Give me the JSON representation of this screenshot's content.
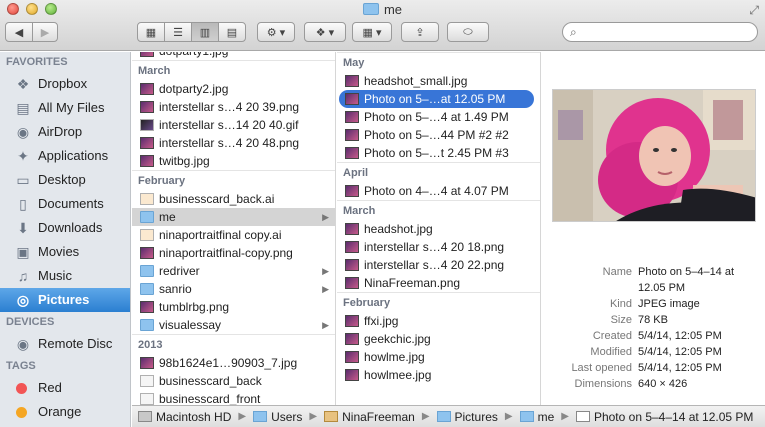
{
  "window": {
    "title": "me"
  },
  "toolbar": {
    "back_icon": "◀",
    "forward_icon": "▶",
    "view_icons": [
      "▦",
      "☰",
      "▥",
      "▤"
    ],
    "action_icon": "⚙ ▾",
    "dropbox_icon": "❖ ▾",
    "arrange_icon": "▦ ▾",
    "share_icon": "⇪",
    "tags_icon": "⬭",
    "search_placeholder": ""
  },
  "sidebar": {
    "sections": [
      {
        "header": "FAVORITES",
        "items": [
          {
            "label": "Dropbox",
            "icon": "❖"
          },
          {
            "label": "All My Files",
            "icon": "▤"
          },
          {
            "label": "AirDrop",
            "icon": "◉"
          },
          {
            "label": "Applications",
            "icon": "✦"
          },
          {
            "label": "Desktop",
            "icon": "▭"
          },
          {
            "label": "Documents",
            "icon": "▯"
          },
          {
            "label": "Downloads",
            "icon": "⬇"
          },
          {
            "label": "Movies",
            "icon": "▣"
          },
          {
            "label": "Music",
            "icon": "♫"
          },
          {
            "label": "Pictures",
            "icon": "◎",
            "selected": true
          }
        ]
      },
      {
        "header": "DEVICES",
        "items": [
          {
            "label": "Remote Disc",
            "icon": "◉"
          }
        ]
      },
      {
        "header": "TAGS",
        "items": [
          {
            "label": "Red",
            "color": "#f25555"
          },
          {
            "label": "Orange",
            "color": "#f5a623"
          }
        ]
      }
    ]
  },
  "column1": {
    "groups": [
      {
        "header": "",
        "items": [
          {
            "name": "dotparty1.jpg",
            "type": "img"
          }
        ]
      },
      {
        "header": "March",
        "items": [
          {
            "name": "dotparty2.jpg",
            "type": "img"
          },
          {
            "name": "interstellar s…4 20 39.png",
            "type": "img"
          },
          {
            "name": "interstellar s…14 20 40.gif",
            "type": "gif"
          },
          {
            "name": "interstellar s…4 20 48.png",
            "type": "img"
          },
          {
            "name": "twitbg.jpg",
            "type": "img"
          }
        ]
      },
      {
        "header": "February",
        "items": [
          {
            "name": "businesscard_back.ai",
            "type": "ai"
          },
          {
            "name": "me",
            "type": "fold",
            "folder": true,
            "selected": true
          },
          {
            "name": "ninaportraitfinal copy.ai",
            "type": "ai"
          },
          {
            "name": "ninaportraitfinal-copy.png",
            "type": "img"
          },
          {
            "name": "redriver",
            "type": "fold",
            "folder": true
          },
          {
            "name": "sanrio",
            "type": "fold",
            "folder": true
          },
          {
            "name": "tumblrbg.png",
            "type": "img"
          },
          {
            "name": "visualessay",
            "type": "fold",
            "folder": true
          }
        ]
      },
      {
        "header": "2013",
        "items": [
          {
            "name": "98b1624e1…90903_7.jpg",
            "type": "img"
          },
          {
            "name": "businesscard_back",
            "type": "doc"
          },
          {
            "name": "businesscard_front",
            "type": "doc"
          }
        ]
      }
    ]
  },
  "column2": {
    "groups": [
      {
        "header": "May",
        "items": [
          {
            "name": "headshot_small.jpg",
            "type": "img"
          },
          {
            "name": "Photo on 5–…at 12.05 PM",
            "type": "img",
            "selected": true
          },
          {
            "name": "Photo on 5–…4 at 1.49 PM",
            "type": "img"
          },
          {
            "name": "Photo on 5–…44 PM #2 #2",
            "type": "img"
          },
          {
            "name": "Photo on 5–…t 2.45 PM #3",
            "type": "img"
          }
        ]
      },
      {
        "header": "April",
        "items": [
          {
            "name": "Photo on 4–…4 at 4.07 PM",
            "type": "img"
          }
        ]
      },
      {
        "header": "March",
        "items": [
          {
            "name": "headshot.jpg",
            "type": "img"
          },
          {
            "name": "interstellar s…4 20 18.png",
            "type": "img"
          },
          {
            "name": "interstellar s…4 20 22.png",
            "type": "img"
          },
          {
            "name": "NinaFreeman.png",
            "type": "img"
          }
        ]
      },
      {
        "header": "February",
        "items": [
          {
            "name": "ffxi.jpg",
            "type": "img"
          },
          {
            "name": "geekchic.jpg",
            "type": "img"
          },
          {
            "name": "howlme.jpg",
            "type": "img"
          },
          {
            "name": "howlmee.jpg",
            "type": "img"
          }
        ]
      }
    ]
  },
  "preview": {
    "info": [
      {
        "key": "Name",
        "value": "Photo on 5–4–14 at",
        "value2": "12.05 PM"
      },
      {
        "key": "Kind",
        "value": "JPEG image"
      },
      {
        "key": "Size",
        "value": "78 KB"
      },
      {
        "key": "Created",
        "value": "5/4/14, 12:05 PM"
      },
      {
        "key": "Modified",
        "value": "5/4/14, 12:05 PM"
      },
      {
        "key": "Last opened",
        "value": "5/4/14, 12:05 PM"
      },
      {
        "key": "Dimensions",
        "value": "640 × 426"
      }
    ]
  },
  "pathbar": {
    "crumbs": [
      {
        "label": "Macintosh HD",
        "kind": "hd"
      },
      {
        "label": "Users",
        "kind": "folder"
      },
      {
        "label": "NinaFreeman",
        "kind": "home"
      },
      {
        "label": "Pictures",
        "kind": "folder"
      },
      {
        "label": "me",
        "kind": "folder"
      },
      {
        "label": "Photo on 5–4–14 at 12.05 PM",
        "kind": "file"
      }
    ]
  }
}
